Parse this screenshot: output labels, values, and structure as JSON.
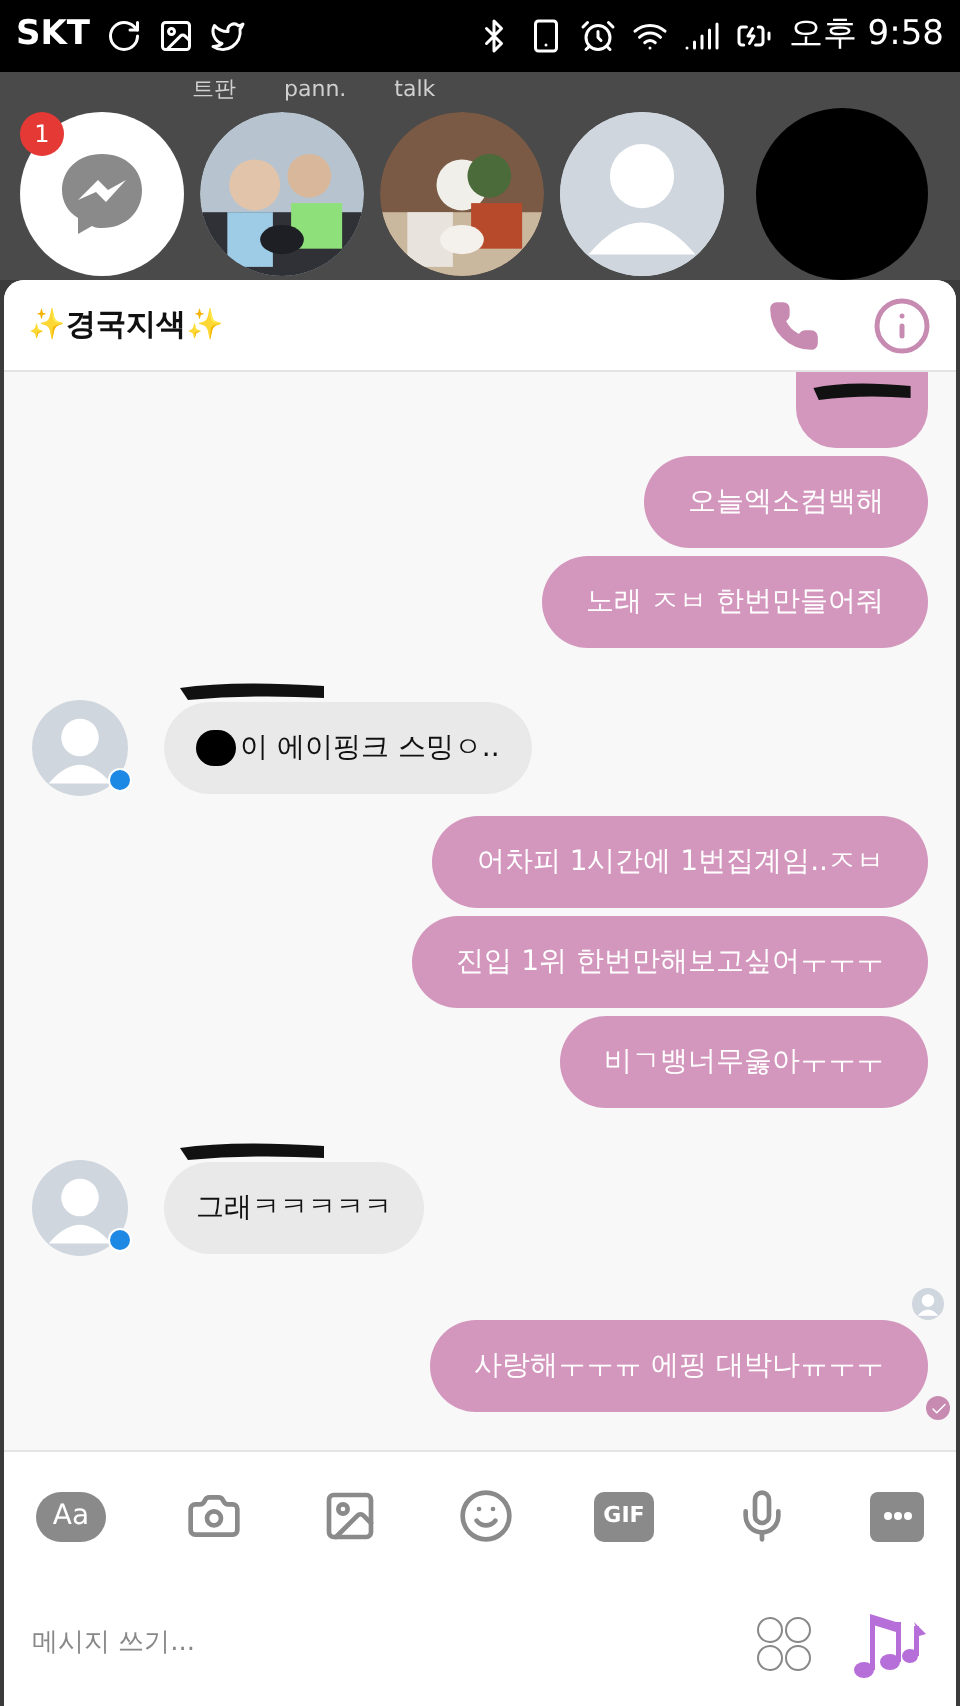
{
  "status_bar": {
    "carrier": "SKT",
    "time": "오후 9:58"
  },
  "background_texts": [
    "트판",
    "pann.",
    "talk"
  ],
  "chat_heads": [
    {
      "kind": "messenger",
      "badge": "1"
    },
    {
      "kind": "picture"
    },
    {
      "kind": "picture"
    },
    {
      "kind": "avatar"
    },
    {
      "kind": "redacted"
    }
  ],
  "header": {
    "title": "✨경국지색✨"
  },
  "messages": [
    {
      "kind": "redacted",
      "outgoing": true
    },
    {
      "kind": "text",
      "outgoing": true,
      "text": "오늘엑소컴백해"
    },
    {
      "kind": "text",
      "outgoing": true,
      "text": "노래 ㅈㅂ 한번만들어줘"
    },
    {
      "kind": "text",
      "outgoing": false,
      "text": "이 에이핑크 스밍ㅇ..",
      "redacted_prefix": true
    },
    {
      "kind": "text",
      "outgoing": true,
      "text": "어차피 1시간에 1번집계임..ㅈㅂ"
    },
    {
      "kind": "text",
      "outgoing": true,
      "text": "진입 1위 한번만해보고싶어ㅜㅜㅜ"
    },
    {
      "kind": "text",
      "outgoing": true,
      "text": "비ㄱ뱅너무욿아ㅜㅜㅜ"
    },
    {
      "kind": "text",
      "outgoing": false,
      "text": "그래ㅋㅋㅋㅋㅋ",
      "redacted_prefix": false
    },
    {
      "kind": "seen"
    },
    {
      "kind": "text",
      "outgoing": true,
      "text": "사랑해ㅜㅜㅠ 에핑 대박나ㅠㅜㅜ",
      "delivered": true
    }
  ],
  "toolbar": {
    "text_button": "Aa",
    "gif_button": "GIF"
  },
  "composer": {
    "placeholder": "메시지 쓰기..."
  }
}
